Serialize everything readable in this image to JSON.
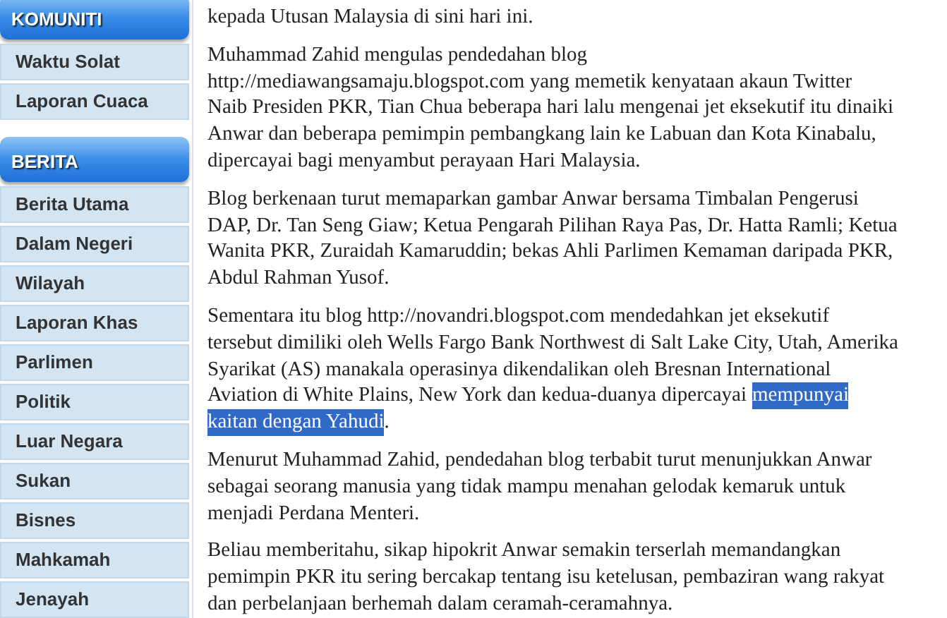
{
  "sidebar": [
    {
      "title": "KOMUNITI",
      "items": [
        "Waktu Solat",
        "Laporan Cuaca"
      ]
    },
    {
      "title": "BERITA",
      "items": [
        "Berita Utama",
        "Dalam Negeri",
        "Wilayah",
        "Laporan Khas",
        "Parlimen",
        "Politik",
        "Luar Negara",
        "Sukan",
        "Bisnes",
        "Mahkamah",
        "Jenayah"
      ]
    }
  ],
  "article": {
    "paragraphs": [
      {
        "lines": [
          [
            {
              "text": "kepada Utusan Malaysia di sini hari ini.",
              "selected": false
            }
          ]
        ]
      },
      {
        "lines": [
          [
            {
              "text": "Muhammad Zahid mengulas pendedahan blog",
              "selected": false
            }
          ],
          [
            {
              "text": "http://mediawangsamaju.blogspot.com yang memetik kenyataan akaun Twitter",
              "selected": false
            }
          ],
          [
            {
              "text": "Naib Presiden PKR, Tian Chua beberapa hari lalu mengenai jet eksekutif itu dinaiki",
              "selected": false
            }
          ],
          [
            {
              "text": "Anwar dan beberapa pemimpin pembangkang lain ke Labuan dan Kota Kinabalu,",
              "selected": false
            }
          ],
          [
            {
              "text": "dipercayai bagi menyambut perayaan Hari Malaysia.",
              "selected": false
            }
          ]
        ]
      },
      {
        "lines": [
          [
            {
              "text": "Blog berkenaan turut memaparkan gambar Anwar bersama Timbalan Pengerusi",
              "selected": false
            }
          ],
          [
            {
              "text": "DAP, Dr. Tan Seng Giaw; Ketua Pengarah Pilihan Raya Pas, Dr. Hatta Ramli; Ketua",
              "selected": false
            }
          ],
          [
            {
              "text": "Wanita PKR, Zuraidah Kamaruddin; bekas Ahli Parlimen Kemaman daripada PKR,",
              "selected": false
            }
          ],
          [
            {
              "text": "Abdul Rahman Yusof.",
              "selected": false
            }
          ]
        ]
      },
      {
        "lines": [
          [
            {
              "text": "Sementara itu blog http://novandri.blogspot.com mendedahkan jet eksekutif",
              "selected": false
            }
          ],
          [
            {
              "text": "tersebut dimiliki oleh Wells Fargo Bank Northwest di Salt Lake City, Utah, Amerika",
              "selected": false
            }
          ],
          [
            {
              "text": "Syarikat (AS) manakala operasinya dikendalikan oleh Bresnan International",
              "selected": false
            }
          ],
          [
            {
              "text": "Aviation di White Plains, New York dan kedua-duanya dipercayai",
              "selected": false
            },
            {
              "text": "mempunyai",
              "selected": true
            }
          ],
          [
            {
              "text": "kaitan dengan Yahudi",
              "selected": true
            },
            {
              "text": ".",
              "selected": false
            }
          ]
        ]
      },
      {
        "lines": [
          [
            {
              "text": "Menurut Muhammad Zahid, pendedahan blog terbabit turut menunjukkan Anwar",
              "selected": false
            }
          ],
          [
            {
              "text": "sebagai seorang manusia yang tidak mampu menahan gelodak kemaruk untuk",
              "selected": false
            }
          ],
          [
            {
              "text": "menjadi Perdana Menteri.",
              "selected": false
            }
          ]
        ]
      },
      {
        "lines": [
          [
            {
              "text": "Beliau memberitahu, sikap hipokrit Anwar semakin terserlah memandangkan",
              "selected": false
            }
          ],
          [
            {
              "text": "pemimpin PKR itu sering bercakap tentang isu ketelusan, pembaziran wang rakyat",
              "selected": false
            }
          ],
          [
            {
              "text": "dan perbelanjaan berhemah dalam ceramah-ceramahnya.",
              "selected": false
            }
          ]
        ]
      }
    ]
  }
}
